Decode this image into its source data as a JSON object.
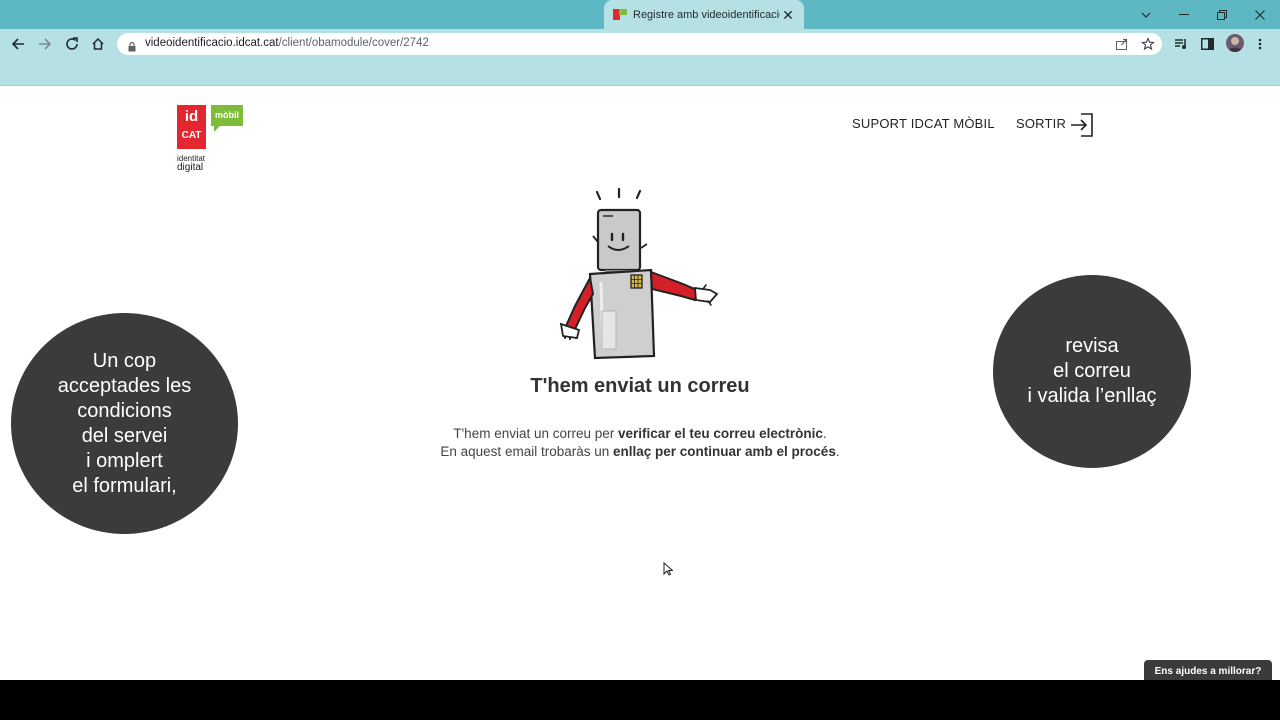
{
  "browser": {
    "tab_title": "Registre amb videoidentificació",
    "tab_close": "✕",
    "url_host": "videoidentificacio.idcat.cat",
    "url_path": "/client/obamodule/cover/2742",
    "icons": [
      "back-icon",
      "forward-icon",
      "reload-icon",
      "home-icon",
      "lock-icon",
      "share-icon",
      "star-icon",
      "media-icon",
      "sidebar-icon",
      "profile-avatar",
      "menu-icon",
      "minimize-icon",
      "maximize-icon",
      "close-window-icon",
      "tab-list-icon"
    ]
  },
  "header": {
    "logo": {
      "id": "id",
      "cat": "CAT",
      "mobil": "mòbil",
      "identitat": "identitat",
      "digital": "digital"
    },
    "support_link": "SUPORT IDCAT MÒBIL",
    "exit_link": "SORTIR"
  },
  "main": {
    "heading": "T'hem enviat un correu",
    "line1_prefix": "T'hem enviat un correu per ",
    "line1_bold": "verificar el teu correu electrònic",
    "line1_suffix": ".",
    "line2_prefix": "En aquest email trobaràs un ",
    "line2_bold": "enllaç per continuar amb el procés",
    "line2_suffix": "."
  },
  "bubbles": {
    "left": "Un cop\nacceptades les\ncondicions\ndel servei\ni omplert\nel formulari,",
    "right": "revisa\nel correu\ni valida l’enllaç"
  },
  "feedback_button": "Ens ajudes a millorar?",
  "colors": {
    "titlebar": "#5eb8c4",
    "toolbar": "#b5e0e4",
    "brand_red": "#e3262f",
    "brand_green": "#7fbc3b",
    "bubble": "#3b3b3b"
  }
}
